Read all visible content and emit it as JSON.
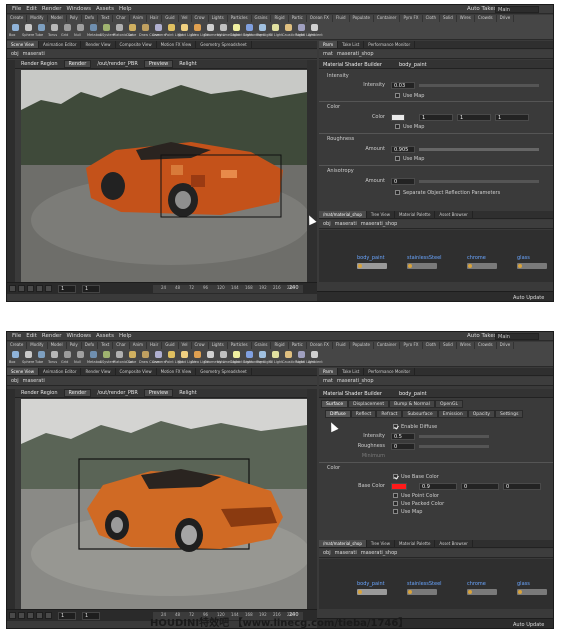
{
  "menu": [
    "File",
    "Edit",
    "Render",
    "Windows",
    "Assets",
    "Help"
  ],
  "auto_takes": "Auto Takes",
  "desktop": "Main",
  "shelf_tabs": [
    "Create",
    "Modify",
    "Model",
    "Poly",
    "Defo",
    "Text",
    "Char",
    "Anim",
    "Hair",
    "Guid",
    "Vel",
    "Crow",
    "Lights",
    "Particles",
    "Grains",
    "Rigid",
    "Partic",
    "Ocean FX",
    "Fluid",
    "Populate",
    "Container",
    "Pyro FX",
    "Cloth",
    "Solid",
    "Wires",
    "Crowds",
    "Drive"
  ],
  "shelf_tools": [
    "Box",
    "Sphere",
    "Tube",
    "Torus",
    "Grid",
    "Null",
    "Metaball",
    "LSystem",
    "Platonic Sol",
    "Curve",
    "Draw Curve",
    "Camera",
    "Point Light",
    "Spot Light",
    "Area Light",
    "Geometry Li",
    "Volume Light",
    "Distant Light",
    "Environment",
    "Sky Light",
    "GI Light",
    "Caustic Light",
    "Portal Light",
    "Ambient"
  ],
  "viewer_tabs": [
    "Scene View",
    "Animation Editor",
    "Render View",
    "Composite View",
    "Motion FX View",
    "Geometry Spreadsheet"
  ],
  "param_tabs": [
    "Parm",
    "Take List",
    "Performance Monitor"
  ],
  "net_tabs": [
    "/mat/material_shop",
    "Tree View",
    "Material Palette",
    "Asset Browser"
  ],
  "viewer_path": [
    "obj",
    "maserati"
  ],
  "param_path": [
    "mat",
    "maserati_shop"
  ],
  "render_region_label": "Render Region",
  "render_button": "Render",
  "render_node": "/out/render_PBR",
  "preview": "Preview",
  "relight": "Relight",
  "node_type": "Material Shader Builder",
  "node_name": "body_paint",
  "timeline": {
    "frame": "1",
    "start": "1",
    "end": "240",
    "ticks": [
      "24",
      "48",
      "72",
      "96",
      "120",
      "144",
      "168",
      "192",
      "216",
      "240"
    ],
    "auto_update": "Auto Update"
  },
  "s1": {
    "intensity_section": "Intensity",
    "intensity_label": "Intensity",
    "intensity_value": "0.03",
    "use_map": "Use Map",
    "color_section": "Color",
    "color_label": "Color",
    "color_values": [
      "1",
      "1",
      "1"
    ],
    "roughness_section": "Roughness",
    "amount_label": "Amount",
    "roughness_value": "0.905",
    "anisotropy_section": "Anisotropy",
    "anisotropy_value": "0",
    "sep_reflection": "Separate Object Reflection Parameters",
    "nodes": [
      "body_paint",
      "stainlessSteel",
      "chrome",
      "glass"
    ]
  },
  "s2": {
    "top_tabs": [
      "Surface",
      "Displacement",
      "Bump & Normal",
      "OpenGL"
    ],
    "sub_tabs": [
      "Diffuse",
      "Reflect",
      "Refract",
      "Subsurface",
      "Emission",
      "Opacity",
      "Settings"
    ],
    "enable_diffuse": "Enable Diffuse",
    "intensity_label": "Intensity",
    "intensity_value": "0.5",
    "roughness_label": "Roughness",
    "roughness_value": "0",
    "minimum_label": "Minimum",
    "color_section": "Color",
    "use_base_color": "Use Base Color",
    "base_color_label": "Base Color",
    "base_color_values": [
      "0.9",
      "0",
      "0"
    ],
    "use_point_color": "Use Point Color",
    "use_packed_color": "Use Packed Color",
    "use_map": "Use Map",
    "nodes": [
      "body_paint",
      "stainlessSteel",
      "chrome",
      "glass"
    ]
  },
  "watermark": "HOUDINI特效吧  【www.linecg.com/tieba/1746】",
  "colors": {
    "car": "#c4521a",
    "base_color": "#ff1a1a",
    "node_text": "#6aa6ff",
    "accent": "#d9a33a"
  }
}
